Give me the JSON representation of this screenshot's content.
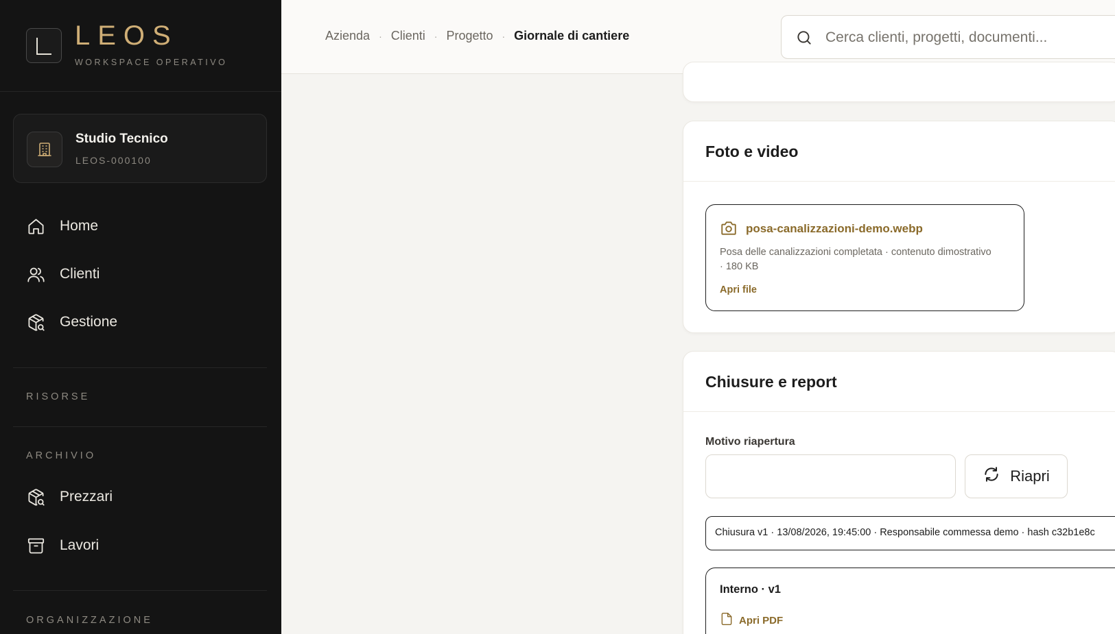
{
  "brand": {
    "name": "LEOS",
    "subtitle": "WORKSPACE OPERATIVO"
  },
  "org": {
    "name": "Studio Tecnico",
    "code": "LEOS-000100"
  },
  "nav": {
    "main": [
      {
        "label": "Home",
        "icon": "home-icon"
      },
      {
        "label": "Clienti",
        "icon": "users-icon"
      },
      {
        "label": "Gestione",
        "icon": "package-search-icon"
      }
    ],
    "risorse_label": "RISORSE",
    "archivio_label": "ARCHIVIO",
    "archivio": [
      {
        "label": "Prezzari",
        "icon": "package-search-icon"
      },
      {
        "label": "Lavori",
        "icon": "archive-icon"
      }
    ],
    "organizzazione_label": "ORGANIZZAZIONE"
  },
  "breadcrumb": [
    "Azienda",
    "Clienti",
    "Progetto",
    "Giornale di cantiere"
  ],
  "search": {
    "placeholder": "Cerca clienti, progetti, documenti...",
    "value": ""
  },
  "media": {
    "title": "Foto e video",
    "file": {
      "name": "posa-canalizzazioni-demo.webp",
      "description": "Posa delle canalizzazioni completata · contenuto dimostrativo · 180 KB",
      "link": "Apri file"
    }
  },
  "closures": {
    "title": "Chiusure e report",
    "reason_label": "Motivo riapertura",
    "reason_value": "",
    "reopen_button": "Riapri",
    "closure_entry": "Chiusura v1 · 13/08/2026, 19:45:00 · Responsabile commessa demo · hash c32b1e8c",
    "report": {
      "title": "Interno · v1",
      "link": "Apri PDF"
    }
  },
  "colors": {
    "accent": "#8a6a2a",
    "brand_gold": "#cfae76",
    "sidebar_bg": "#141414"
  }
}
